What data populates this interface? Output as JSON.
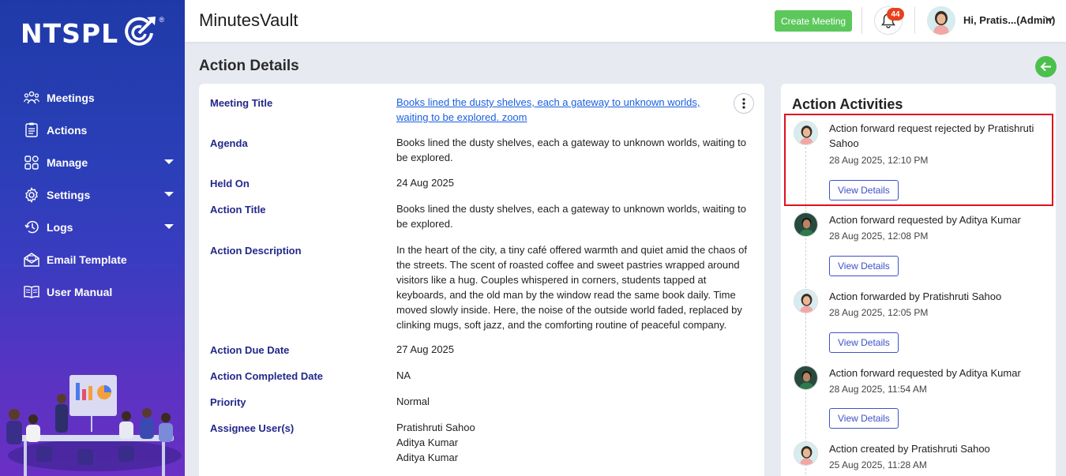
{
  "brand": {
    "logo_text": "NTSPL",
    "reg_mark": "®"
  },
  "sidebar": {
    "items": [
      {
        "label": "Meetings",
        "icon": "meetings-icon",
        "has_submenu": false
      },
      {
        "label": "Actions",
        "icon": "actions-icon",
        "has_submenu": false
      },
      {
        "label": "Manage",
        "icon": "manage-icon",
        "has_submenu": true
      },
      {
        "label": "Settings",
        "icon": "gear-icon",
        "has_submenu": true
      },
      {
        "label": "Logs",
        "icon": "history-icon",
        "has_submenu": true
      },
      {
        "label": "Email Template",
        "icon": "email-icon",
        "has_submenu": false
      },
      {
        "label": "User Manual",
        "icon": "book-icon",
        "has_submenu": false
      }
    ]
  },
  "header": {
    "app_title": "MinutesVault",
    "create_meeting_label": "Create Meeting",
    "notification_count": "44",
    "user_greeting": "Hi, Pratis...(Admin)"
  },
  "page": {
    "title": "Action Details"
  },
  "details": {
    "meeting_title_label": "Meeting Title",
    "meeting_title_line1": "Books lined the dusty shelves, each a gateway to unknown worlds,",
    "meeting_title_line2": "waiting to be explored. zoom",
    "agenda_label": "Agenda",
    "agenda_value": "Books lined the dusty shelves, each a gateway to unknown worlds, waiting to be explored.",
    "held_on_label": "Held On",
    "held_on_value": "24 Aug 2025",
    "action_title_label": "Action Title",
    "action_title_value": "Books lined the dusty shelves, each a gateway to unknown worlds, waiting to be explored.",
    "action_description_label": "Action Description",
    "action_description_value": "In the heart of the city, a tiny café offered warmth and quiet amid the chaos of the streets. The scent of roasted coffee and sweet pastries wrapped around visitors like a hug. Couples whispered in corners, students tapped at keyboards, and the old man by the window read the same book daily. Time moved slowly inside. Here, the noise of the outside world faded, replaced by clinking mugs, soft jazz, and the comforting routine of peaceful company.",
    "action_due_date_label": "Action Due Date",
    "action_due_date_value": "27 Aug 2025",
    "action_completed_date_label": "Action Completed Date",
    "action_completed_date_value": "NA",
    "priority_label": "Priority",
    "priority_value": "Normal",
    "assignee_label": "Assignee User(s)",
    "assignees": [
      "Pratishruti Sahoo",
      "Aditya Kumar",
      "Aditya Kumar"
    ]
  },
  "activities": {
    "title": "Action Activities",
    "view_details_label": "View Details",
    "items": [
      {
        "text": "Action forward request rejected by Pratishruti Sahoo",
        "time": "28 Aug 2025, 12:10 PM",
        "user": "female",
        "highlighted": true
      },
      {
        "text": "Action forward requested by Aditya Kumar",
        "time": "28 Aug 2025, 12:08 PM",
        "user": "male"
      },
      {
        "text": "Action forwarded by Pratishruti Sahoo",
        "time": "28 Aug 2025, 12:05 PM",
        "user": "female"
      },
      {
        "text": "Action forward requested by Aditya Kumar",
        "time": "28 Aug 2025, 11:54 AM",
        "user": "male"
      },
      {
        "text": "Action created by Pratishruti Sahoo",
        "time": "25 Aug 2025, 11:28 AM",
        "user": "female"
      }
    ]
  },
  "colors": {
    "sidebar_top": "#1f3aa8",
    "sidebar_bottom": "#6a2fc4",
    "label_navy": "#22288a",
    "link_blue": "#1a5fe0",
    "create_green": "#5cc85c",
    "badge_red": "#e8401c",
    "highlight_red": "#e01020"
  }
}
